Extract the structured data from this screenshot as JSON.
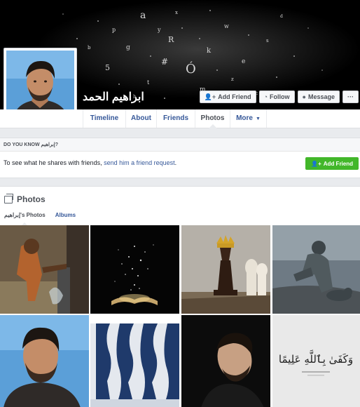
{
  "profile": {
    "name": "ابراهيم الحمد"
  },
  "cover_actions": [
    {
      "label": "Add Friend",
      "icon": "add-friend-icon"
    },
    {
      "label": "Follow",
      "icon": "rss-icon"
    },
    {
      "label": "Message",
      "icon": "messenger-icon"
    },
    {
      "label": "···",
      "icon": "more-icon"
    }
  ],
  "tabs": [
    {
      "label": "Timeline"
    },
    {
      "label": "About"
    },
    {
      "label": "Friends"
    },
    {
      "label": "Photos",
      "active": true
    },
    {
      "label": "More",
      "caret": "▼"
    }
  ],
  "know": {
    "heading": "DO YOU KNOW إبراهيم?",
    "text_prefix": "To see what he shares with friends, ",
    "link": "send him a friend request",
    "text_suffix": ".",
    "button": "Add Friend"
  },
  "photos": {
    "title": "Photos",
    "tabs": [
      {
        "label": "إبراهيم's Photos",
        "active": true
      },
      {
        "label": "Albums"
      }
    ],
    "calligraphy": "وَكَفَىٰ بِٱللَّهِ عَلِيمًا"
  },
  "colors": {
    "link": "#365899",
    "green": "#42b72a",
    "background": "#e9ebee"
  }
}
